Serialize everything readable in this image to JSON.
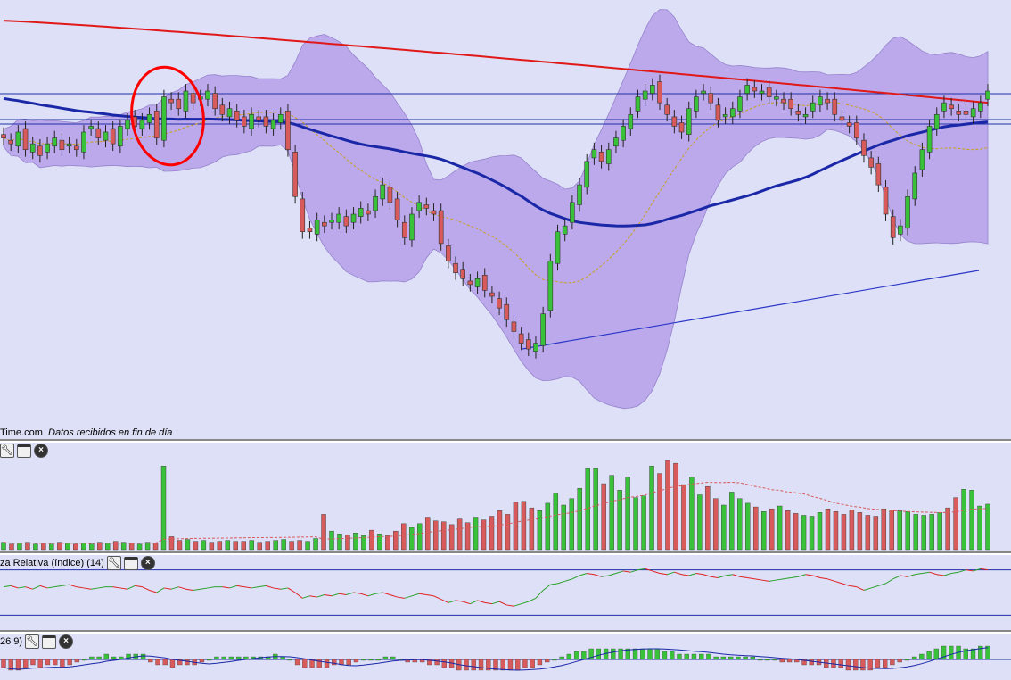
{
  "caption": {
    "source": "Time.com",
    "note": "Datos recibidos en fin de día"
  },
  "indicator_titles": {
    "rsi": "za Relativa (índice) (14)",
    "macd": "26 9)"
  },
  "toolbar_icons": [
    "wrench-icon",
    "window-icon",
    "close-icon"
  ],
  "colors": {
    "background": "#dde0f6",
    "bollinger_fill": "#b8a4ea",
    "bollinger_edge": "#8e78c8",
    "ma200": "#e01818",
    "ma50": "#1a28a8",
    "ma20": "#c8a020",
    "up": "#39c239",
    "down": "#d85a5a",
    "trendline": "#2a36c8",
    "annotation": "#ff0000",
    "rsi_line_up": "#2aa02a",
    "rsi_line_down": "#e02020",
    "guide": "#2030a8"
  },
  "chart_data": [
    {
      "type": "candlestick",
      "title": "",
      "overlays": [
        "bollinger-bands",
        "moving-average-20",
        "moving-average-50",
        "moving-average-200"
      ],
      "closes": [
        68,
        67,
        69,
        66,
        67,
        65,
        67,
        68,
        66,
        67,
        66,
        69,
        70,
        68,
        69,
        67,
        70,
        71,
        70,
        71,
        72,
        68,
        75,
        74,
        73,
        76,
        74,
        75,
        76,
        73,
        72,
        73,
        71,
        70,
        72,
        71,
        70,
        71,
        72,
        66,
        58,
        52,
        52,
        54,
        53,
        54,
        55,
        53,
        55,
        56,
        55,
        58,
        60,
        57,
        54,
        51,
        55,
        57,
        56,
        55,
        50,
        47,
        45,
        44,
        43,
        44,
        42,
        41,
        39,
        37,
        35,
        33,
        32,
        33,
        38,
        47,
        52,
        53,
        57,
        60,
        64,
        66,
        64,
        66,
        68,
        70,
        72,
        75,
        76,
        77,
        74,
        72,
        70,
        69,
        73,
        75,
        76,
        74,
        71,
        72,
        73,
        75,
        77,
        76,
        76,
        75,
        75,
        74,
        73,
        72,
        72,
        74,
        75,
        74,
        72,
        71,
        70,
        68,
        65,
        63,
        60,
        55,
        51,
        53,
        58,
        62,
        66,
        70,
        72,
        74,
        73,
        72,
        72,
        73,
        74,
        76
      ]
    },
    {
      "type": "bar",
      "title": "",
      "series_name": "",
      "values": [
        8,
        6,
        7,
        8,
        6,
        7,
        6,
        8,
        7,
        6,
        7,
        6,
        8,
        7,
        9,
        8,
        7,
        6,
        8,
        7,
        90,
        14,
        10,
        11,
        9,
        10,
        8,
        9,
        10,
        9,
        9,
        10,
        8,
        9,
        10,
        11,
        9,
        10,
        9,
        12,
        38,
        20,
        17,
        16,
        18,
        15,
        21,
        17,
        15,
        20,
        28,
        24,
        28,
        35,
        31,
        30,
        27,
        33,
        29,
        35,
        32,
        36,
        42,
        38,
        51,
        52,
        45,
        42,
        50,
        61,
        48,
        55,
        66,
        88,
        88,
        71,
        80,
        64,
        78,
        56,
        58,
        90,
        82,
        96,
        93,
        70,
        78,
        59,
        68,
        55,
        48,
        62,
        55,
        50,
        46,
        41,
        44,
        47,
        42,
        39,
        37,
        36,
        40,
        44,
        41,
        38,
        43,
        40,
        37,
        36,
        44,
        43,
        42,
        41,
        38,
        37,
        38,
        40,
        45,
        56,
        65,
        64,
        47,
        49
      ]
    },
    {
      "type": "line",
      "title": "",
      "series_name": "",
      "values": [
        55,
        56,
        54,
        55,
        53,
        56,
        54,
        55,
        56,
        57,
        55,
        54,
        53,
        54,
        55,
        55,
        54,
        53,
        56,
        55,
        52,
        50,
        54,
        53,
        55,
        53,
        52,
        53,
        54,
        55,
        55,
        54,
        56,
        55,
        54,
        55,
        56,
        54,
        53,
        54,
        50,
        45,
        47,
        46,
        48,
        47,
        49,
        48,
        50,
        49,
        47,
        49,
        50,
        48,
        46,
        45,
        47,
        49,
        48,
        47,
        44,
        41,
        43,
        42,
        40,
        43,
        41,
        40,
        42,
        39,
        38,
        40,
        42,
        45,
        52,
        57,
        58,
        60,
        62,
        65,
        67,
        66,
        64,
        65,
        67,
        69,
        68,
        70,
        71,
        69,
        67,
        66,
        68,
        66,
        65,
        67,
        66,
        64,
        63,
        65,
        66,
        64,
        63,
        62,
        61,
        60,
        61,
        62,
        63,
        64,
        66,
        65,
        63,
        62,
        60,
        58,
        56,
        55,
        52,
        54,
        56,
        58,
        62,
        65,
        64,
        66,
        67,
        68,
        66,
        65,
        67,
        68,
        70,
        69,
        71,
        70
      ],
      "guides": [
        70,
        30
      ]
    },
    {
      "type": "bar",
      "title": "",
      "series_name": "",
      "values": [
        -3,
        -4,
        -4,
        -3,
        -2,
        -3,
        -2,
        -2,
        -3,
        -2,
        -1,
        0,
        1,
        1,
        2,
        1,
        1,
        2,
        2,
        2,
        -1,
        -2,
        -2,
        -3,
        -2,
        -2,
        -2,
        -1,
        0,
        1,
        1,
        1,
        1,
        1,
        1,
        1,
        1,
        2,
        1,
        0,
        -2,
        -3,
        -3,
        -3,
        -3,
        -2,
        -2,
        -2,
        -1,
        0,
        0,
        0,
        1,
        1,
        0,
        -1,
        -1,
        -1,
        -2,
        -2,
        -3,
        -3,
        -4,
        -4,
        -4,
        -4,
        -4,
        -4,
        -4,
        -4,
        -4,
        -3,
        -3,
        -2,
        -1,
        0,
        1,
        2,
        3,
        3,
        4,
        4,
        4,
        4,
        4,
        4,
        4,
        4,
        4,
        4,
        3,
        3,
        2,
        2,
        2,
        2,
        2,
        1,
        1,
        1,
        1,
        1,
        1,
        0,
        0,
        0,
        -1,
        -1,
        -1,
        -2,
        -2,
        -2,
        -3,
        -3,
        -3,
        -4,
        -4,
        -4,
        -4,
        -3,
        -3,
        -2,
        -1,
        0,
        1,
        2,
        3,
        4,
        5,
        5,
        5,
        4,
        4,
        5,
        5
      ]
    }
  ]
}
